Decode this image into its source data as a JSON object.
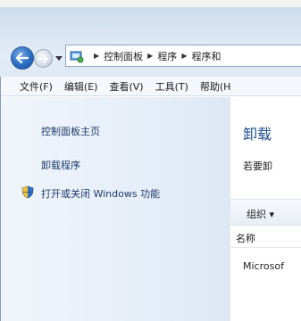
{
  "addressbar": {
    "crumbs": [
      "控制面板",
      "程序",
      "程序和"
    ]
  },
  "menubar": {
    "items": [
      "文件(F)",
      "编辑(E)",
      "查看(V)",
      "工具(T)",
      "帮助(H"
    ]
  },
  "leftpane": {
    "home": "控制面板主页",
    "uninstall": "卸载程序",
    "features": "打开或关闭 Windows 功能"
  },
  "content": {
    "title": "卸载",
    "description": "若要卸",
    "organize": "组织 ▾",
    "column_name": "名称",
    "row_1": "Microsof"
  },
  "colors": {
    "link": "#1e3a6b",
    "title": "#1f4e8c",
    "nav_bg": "#e6eef8"
  },
  "icons": {
    "back": "back-arrow-icon",
    "forward": "forward-arrow-icon",
    "control_panel": "control-panel-icon",
    "shield": "uac-shield-icon"
  }
}
